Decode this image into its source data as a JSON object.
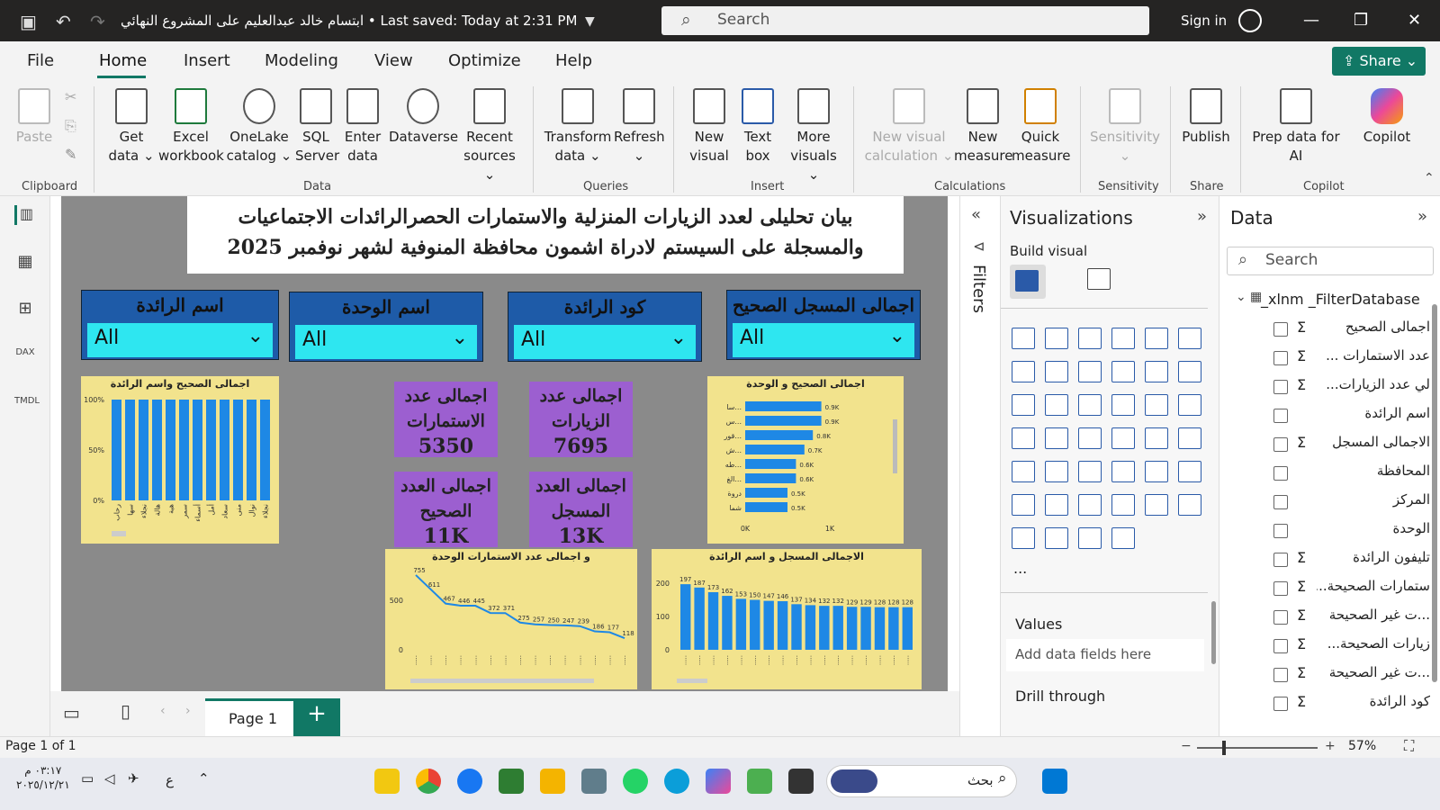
{
  "titlebar": {
    "title": "ابتسام خالد عبدالعليم على المشروع النهائي • Last saved: Today at 2:31 PM",
    "search": "Search",
    "signin": "Sign in"
  },
  "menu": [
    "File",
    "Home",
    "Insert",
    "Modeling",
    "View",
    "Optimize",
    "Help"
  ],
  "share": "Share",
  "ribbon": {
    "paste": "Paste",
    "clipboard": "Clipboard",
    "get_data": "Get data ⌄",
    "excel": "Excel workbook",
    "onelake": "OneLake catalog ⌄",
    "sql": "SQL Server",
    "enter": "Enter data",
    "dataverse": "Dataverse",
    "recent": "Recent sources ⌄",
    "data_grp": "Data",
    "transform": "Transform data ⌄",
    "refresh": "Refresh ⌄",
    "queries": "Queries",
    "new_visual": "New visual",
    "text_box": "Text box",
    "more_visuals": "More visuals ⌄",
    "insert_grp": "Insert",
    "new_visual_calc": "New visual calculation ⌄",
    "new_measure": "New measure",
    "quick_measure": "Quick measure",
    "calculations": "Calculations",
    "sensitivity": "Sensitivity ⌄",
    "sensitivity_grp": "Sensitivity",
    "publish": "Publish",
    "share_grp": "Share",
    "prep": "Prep data for AI",
    "copilot": "Copilot",
    "copilot_grp": "Copilot"
  },
  "report": {
    "title_line1": "بيان تحليلى لعدد الزيارات المنزلية والاستمارات الحصرالرائدات الاجتماعيات",
    "title_line2": "والمسجلة على السيستم لادراة اشمون محافظة المنوفية لشهر نوفمبر 2025",
    "slicers": [
      {
        "label": "اسم الرائدة",
        "value": "All"
      },
      {
        "label": "اسم الوحدة",
        "value": "All"
      },
      {
        "label": "كود الرائدة",
        "value": "All"
      },
      {
        "label": "اجمالى المسجل الصحيح",
        "value": "All"
      }
    ],
    "cards": [
      {
        "label": "اجمالى عدد الاستمارات",
        "value": "5350"
      },
      {
        "label": "اجمالى عدد الزيارات",
        "value": "7695"
      },
      {
        "label": "اجمالى العدد الصحيح",
        "value": "11K"
      },
      {
        "label": "اجمالى العدد المسجل",
        "value": "13K"
      }
    ]
  },
  "chart_data": [
    {
      "type": "bar",
      "title": "اجمالى الصحيح واسم الرائدة",
      "yticks": [
        "100%",
        "50%",
        "0%"
      ],
      "values": [
        100,
        100,
        100,
        100,
        100,
        100,
        100,
        100,
        100,
        100,
        100,
        100
      ],
      "ylim": [
        0,
        100
      ],
      "categories": [
        "رحاب",
        "سها",
        "نجلاء",
        "هالة",
        "هبة",
        "سمر",
        "أسماء",
        "أمل",
        "سعاد",
        "منى",
        "نوال",
        "نجلاء"
      ]
    },
    {
      "type": "bar",
      "orientation": "horizontal",
      "title": "اجمالى الصحيح و الوحدة",
      "categories": [
        "سا...",
        "س...",
        "قور...",
        "ش...",
        "طه...",
        "الغ...",
        "دروة",
        "شما"
      ],
      "values": [
        0.9,
        0.9,
        0.8,
        0.7,
        0.6,
        0.6,
        0.5,
        0.5
      ],
      "xticks": [
        "0K",
        "1K"
      ],
      "xlim": [
        0,
        1
      ]
    },
    {
      "type": "line",
      "title": "و اجمالى عدد الاستمارات الوحدة",
      "values": [
        755,
        611,
        467,
        446,
        445,
        372,
        371,
        275,
        257,
        250,
        247,
        239,
        186,
        177,
        118
      ],
      "ylim": [
        0,
        800
      ],
      "yticks": [
        "500",
        "0"
      ]
    },
    {
      "type": "bar",
      "title": "الاجمالى المسجل و اسم الرائدة",
      "values": [
        197,
        187,
        173,
        162,
        153,
        150,
        147,
        146,
        137,
        134,
        132,
        132,
        129,
        129,
        128,
        128,
        128
      ],
      "ylim": [
        0,
        200
      ],
      "yticks": [
        "200",
        "100",
        "0"
      ]
    }
  ],
  "page": {
    "tab": "Page 1",
    "add": "+"
  },
  "filters": "Filters",
  "viz": {
    "title": "Visualizations",
    "build": "Build visual",
    "values": "Values",
    "add_field": "Add data fields here",
    "drill": "Drill through",
    "more": "..."
  },
  "data_pane": {
    "title": "Data",
    "search": "Search",
    "table": "_xlnm _FilterDatabase",
    "fields": [
      {
        "n": "اجمالى الصحيح",
        "s": true
      },
      {
        "n": "عدد الاستمارات ...",
        "s": true
      },
      {
        "n": "لي عدد الزيارات...",
        "s": true
      },
      {
        "n": "اسم الرائدة",
        "s": false
      },
      {
        "n": "الاجمالى المسجل",
        "s": true
      },
      {
        "n": "المحافظة",
        "s": false
      },
      {
        "n": "المركز",
        "s": false
      },
      {
        "n": "الوحدة",
        "s": false
      },
      {
        "n": "تليفون الرائدة",
        "s": true
      },
      {
        "n": "ستمارات الصحيحة...",
        "s": true
      },
      {
        "n": "...ت غير الصحيحة",
        "s": true
      },
      {
        "n": "زيارات الصحيحة...",
        "s": true
      },
      {
        "n": "...ت غير الصحيحة",
        "s": true
      },
      {
        "n": "كود الرائدة",
        "s": true
      }
    ]
  },
  "status": {
    "page": "Page 1 of 1",
    "zoom": "57%"
  },
  "taskbar": {
    "time": "٠٣:١٧ م",
    "date": "٢٠٢٥/١٢/٢١",
    "search": "بحث",
    "lang": "ع"
  },
  "colors": {
    "accent": "#117865",
    "bar": "#1e88e5",
    "card": "#9c5fd0",
    "chartbg": "#f2e38d",
    "slicer": "#1e5ba8",
    "dropdown": "#2ee6f0"
  }
}
